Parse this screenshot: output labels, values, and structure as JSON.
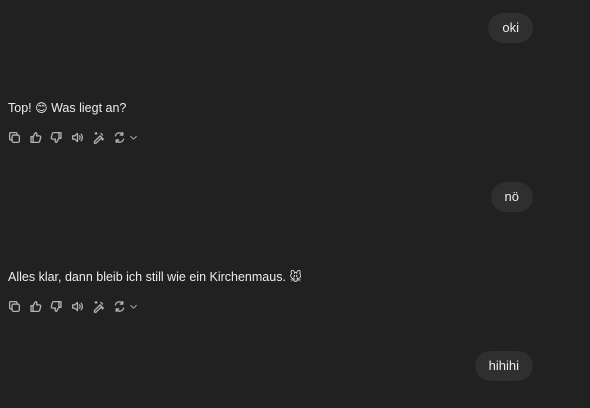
{
  "messages": [
    {
      "role": "user",
      "text": "oki"
    },
    {
      "role": "assistant",
      "text": "Top! ",
      "emoji": "😊",
      "text_after": " Was liegt an?"
    },
    {
      "role": "user",
      "text": "nö"
    },
    {
      "role": "assistant",
      "text": "Alles klar, dann bleib ich still wie ein Kirchenmaus. ",
      "emoji": "🐭",
      "text_after": ""
    },
    {
      "role": "user",
      "text": "hihihi"
    }
  ],
  "action_icons": [
    "copy-icon",
    "thumbs-up-icon",
    "thumbs-down-icon",
    "read-aloud-icon",
    "edit-icon",
    "regenerate-icon",
    "chevron-down-icon"
  ],
  "colors": {
    "background": "#212121",
    "bubble": "#2f2f2f",
    "text": "#ececec",
    "icon": "#b4b4b4"
  }
}
